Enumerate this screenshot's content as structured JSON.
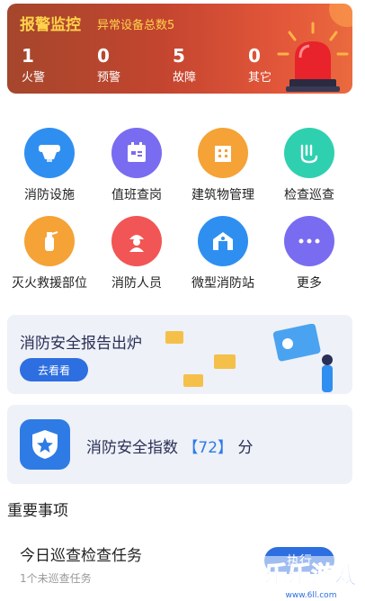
{
  "alarm": {
    "title": "报警监控",
    "subtitle": "异常设备总数5",
    "stats": [
      {
        "value": "1",
        "label": "火警"
      },
      {
        "value": "0",
        "label": "预警"
      },
      {
        "value": "5",
        "label": "故障"
      },
      {
        "value": "0",
        "label": "其它"
      }
    ]
  },
  "grid": [
    {
      "label": "消防设施",
      "icon": "fire-detector-icon",
      "color": "#2f8ff0"
    },
    {
      "label": "值班查岗",
      "icon": "duty-calendar-icon",
      "color": "#7a6cf0"
    },
    {
      "label": "建筑物管理",
      "icon": "building-icon",
      "color": "#f5a236"
    },
    {
      "label": "检查巡查",
      "icon": "inspection-icon",
      "color": "#2fd0b0"
    },
    {
      "label": "灭火救援部位",
      "icon": "extinguisher-icon",
      "color": "#f5a236"
    },
    {
      "label": "消防人员",
      "icon": "firefighter-icon",
      "color": "#f25555"
    },
    {
      "label": "微型消防站",
      "icon": "fire-station-icon",
      "color": "#2f8ff0"
    },
    {
      "label": "更多",
      "icon": "more-icon",
      "color": "#7a6cf0"
    }
  ],
  "report": {
    "title": "消防安全报告出炉",
    "button": "去看看"
  },
  "index": {
    "prefix": "消防安全指数",
    "value": "【72】",
    "suffix": "分"
  },
  "section_title": "重要事项",
  "task": {
    "title": "今日巡查检查任务",
    "subtitle": "1个未巡查任务",
    "button": "执行"
  },
  "watermark": {
    "text": "乐乐游戏",
    "url": "www.6ll.com"
  },
  "colors": {
    "accent": "#2d6ee0",
    "alarm_text": "#ffd24a"
  }
}
